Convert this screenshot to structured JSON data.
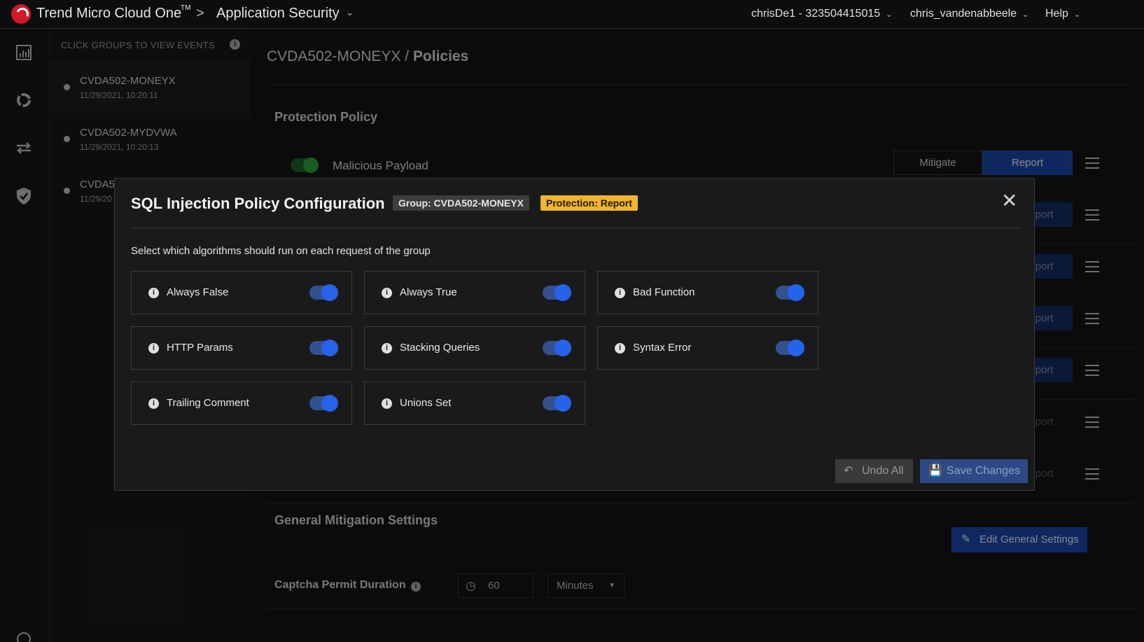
{
  "topbar": {
    "brand": "Trend Micro Cloud One",
    "brand_tm": "TM",
    "separator": ">",
    "app_title": "Application Security",
    "account": "chrisDe1 - 323504415015",
    "user": "chris_vandenabbeele",
    "help": "Help"
  },
  "groups_panel": {
    "header": "CLICK GROUPS TO VIEW EVENTS",
    "items": [
      {
        "name": "CVDA502-MONEYX",
        "date": "11/29/2021, 10:20:11"
      },
      {
        "name": "CVDA502-MYDVWA",
        "date": "11/29/2021, 10:20:13"
      },
      {
        "name": "CVDA5",
        "date": "11/29/20"
      }
    ]
  },
  "main": {
    "title_group": "CVDA502-MONEYX",
    "title_sep": " / ",
    "title_page": "Policies",
    "protection_policy": "Protection Policy",
    "policies": [
      {
        "name": "Malicious Payload",
        "mitigate": "Mitigate",
        "report": "Report"
      },
      {
        "report": "eport"
      },
      {
        "report": "eport"
      },
      {
        "report": "eport"
      },
      {
        "report": "eport"
      },
      {
        "report": "eport"
      },
      {
        "report": "eport"
      }
    ],
    "general_settings": "General Mitigation Settings",
    "edit_general": "Edit General Settings",
    "captcha_label": "Captcha Permit Duration",
    "captcha_value": "60",
    "captcha_unit": "Minutes"
  },
  "modal": {
    "title": "SQL Injection Policy Configuration",
    "group_badge": "Group: CVDA502-MONEYX",
    "protection_badge": "Protection: Report",
    "description": "Select which algorithms should run on each request of the group",
    "algorithms": [
      {
        "label": "Always False",
        "enabled": true
      },
      {
        "label": "Always True",
        "enabled": true
      },
      {
        "label": "Bad Function",
        "enabled": true
      },
      {
        "label": "HTTP Params",
        "enabled": true
      },
      {
        "label": "Stacking Queries",
        "enabled": true
      },
      {
        "label": "Syntax Error",
        "enabled": true
      },
      {
        "label": "Trailing Comment",
        "enabled": true
      },
      {
        "label": "Unions Set",
        "enabled": true
      }
    ],
    "undo_label": "Undo All",
    "save_label": "Save Changes"
  },
  "colors": {
    "accent_blue": "#1d46a6",
    "toggle_on": "#2563eb",
    "protection_badge": "#f1b42c",
    "brand_red": "#d3182a",
    "policy_toggle_green": "#27a23a"
  }
}
